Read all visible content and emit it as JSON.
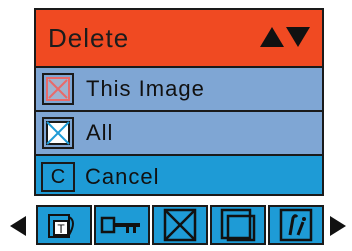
{
  "colors": {
    "header_bg": "#f04a22",
    "item_bg": "#7fa6d4",
    "selected_bg": "#1e9bd6",
    "toolbar_bg": "#1e9bd6"
  },
  "menu": {
    "title": "Delete",
    "items": [
      {
        "label": "This  Image",
        "icon": "delete-image-icon"
      },
      {
        "label": "All",
        "icon": "delete-all-icon"
      }
    ],
    "cancel": {
      "key": "C",
      "label": "Cancel"
    }
  },
  "toolbar": {
    "icons": [
      "protect-icon",
      "key-icon",
      "delete-icon",
      "copy-icon",
      "edit-icon"
    ]
  }
}
